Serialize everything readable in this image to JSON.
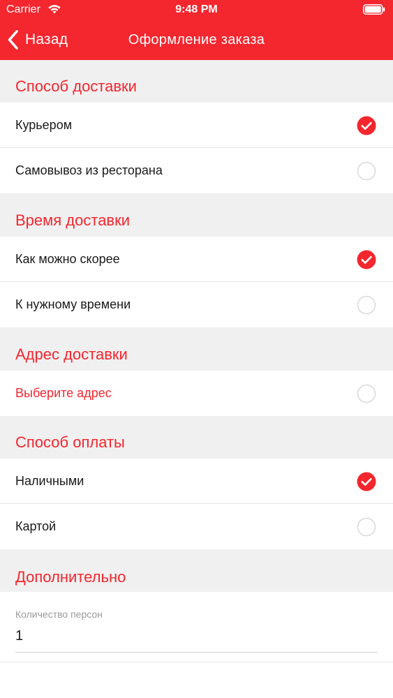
{
  "status_bar": {
    "carrier": "Carrier",
    "time": "9:48 PM"
  },
  "nav": {
    "back_label": "Назад",
    "title": "Оформление заказа"
  },
  "theme": {
    "accent": "#f4262e",
    "header_bg": "#f0f0f0"
  },
  "sections": {
    "delivery_method": {
      "title": "Способ доставки",
      "options": [
        {
          "label": "Курьером",
          "selected": true
        },
        {
          "label": "Самовывоз из ресторана",
          "selected": false
        }
      ]
    },
    "delivery_time": {
      "title": "Время доставки",
      "options": [
        {
          "label": "Как можно скорее",
          "selected": true
        },
        {
          "label": "К нужному времени",
          "selected": false
        }
      ]
    },
    "delivery_address": {
      "title": "Адрес доставки",
      "options": [
        {
          "label": "Выберите адрес",
          "selected": false
        }
      ]
    },
    "payment_method": {
      "title": "Способ оплаты",
      "options": [
        {
          "label": "Наличными",
          "selected": true
        },
        {
          "label": "Картой",
          "selected": false
        }
      ]
    },
    "additional": {
      "title": "Дополнительно",
      "persons_caption": "Количество персон",
      "persons_value": "1"
    }
  },
  "icons": {
    "back": "chevron-left-icon",
    "selected": "checkmark-circle-icon",
    "unselected": "empty-circle-icon",
    "wifi": "wifi-icon",
    "battery": "battery-icon"
  }
}
